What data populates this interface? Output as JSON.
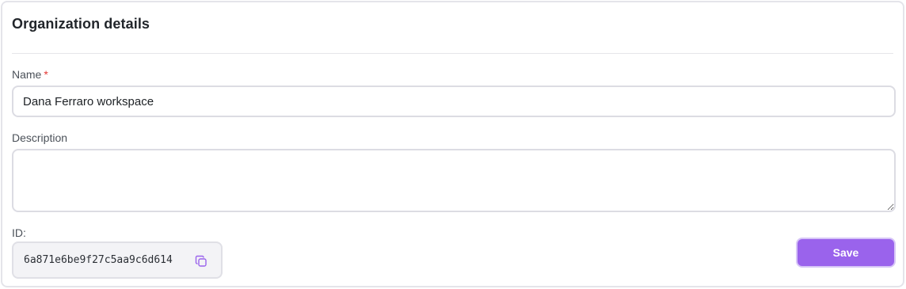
{
  "section": {
    "title": "Organization details"
  },
  "form": {
    "name_label": "Name",
    "name_required_marker": "*",
    "name_value": "Dana Ferraro workspace",
    "description_label": "Description",
    "description_value": "",
    "id_label": "ID:",
    "id_value": "6a871e6be9f27c5aa9c6d614",
    "save_label": "Save"
  },
  "icons": {
    "copy": "copy-icon"
  },
  "colors": {
    "accent": "#9a63ec",
    "required": "#e53935"
  }
}
